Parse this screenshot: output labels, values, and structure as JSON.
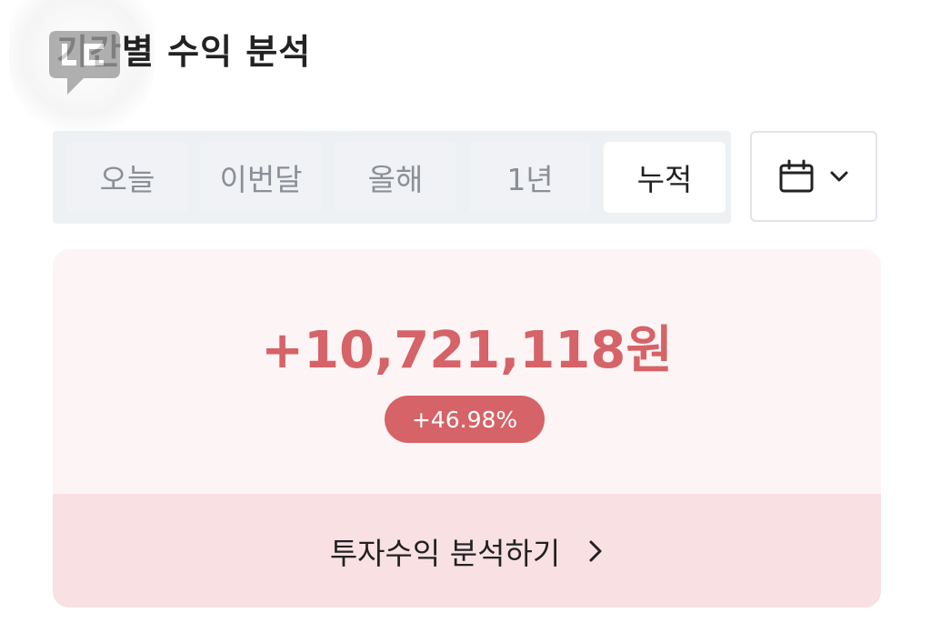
{
  "page": {
    "title": "기간별 수익 분석"
  },
  "tabs": [
    {
      "label": "오늘",
      "active": false
    },
    {
      "label": "이번달",
      "active": false
    },
    {
      "label": "올해",
      "active": false
    },
    {
      "label": "1년",
      "active": false
    },
    {
      "label": "누적",
      "active": true
    }
  ],
  "calendar": {
    "icon": "calendar-icon",
    "dropdown_icon": "chevron-down-icon"
  },
  "summary": {
    "amount": "+10,721,118원",
    "rate": "+46.98%",
    "link_label": "투자수익 분석하기",
    "link_icon": "chevron-right-icon"
  },
  "colors": {
    "accent": "#d56367",
    "card_bg": "#fdf4f5",
    "link_bg": "#f9e0e2",
    "tab_bar_bg": "#eef1f4"
  },
  "floating": {
    "icon": "chat-bubble-icon"
  }
}
